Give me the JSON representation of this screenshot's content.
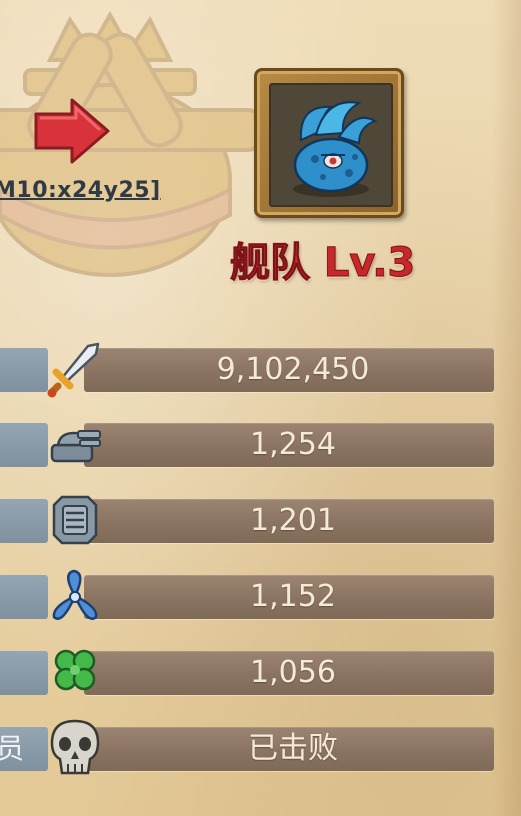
{
  "location_link": "M10:x24y25]",
  "fleet_title": "舰队 Lv.3",
  "stats": [
    {
      "icon": "sword-icon",
      "value": "9,102,450"
    },
    {
      "icon": "turret-icon",
      "value": "1,254"
    },
    {
      "icon": "armor-plate-icon",
      "value": "1,201"
    },
    {
      "icon": "propeller-icon",
      "value": "1,152"
    },
    {
      "icon": "clover-icon",
      "value": "1,056"
    },
    {
      "icon": "skull-icon",
      "value": "已击败"
    }
  ],
  "left_fragment": "员",
  "colors": {
    "title": "#c7292b",
    "arrow": "#d8333b",
    "bar": "#8a7461",
    "text": "#f4ead8"
  }
}
